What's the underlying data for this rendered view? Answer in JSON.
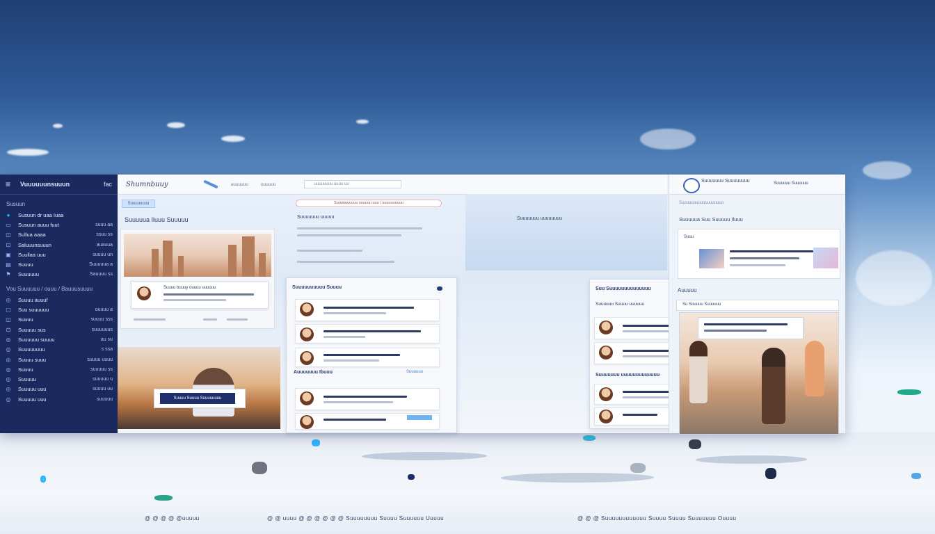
{
  "sidebar": {
    "title": "Vuuuuuunsuuun",
    "corner": "fac",
    "section1": "Susuun",
    "items_a": [
      {
        "icon": "dot-icon",
        "label": "Susuun dr uaa Iuaa",
        "value": ""
      },
      {
        "icon": "square-icon",
        "label": "Susuun auuu fuut",
        "value": "suuu aa"
      },
      {
        "icon": "chat-icon",
        "label": "Sullua aaaa",
        "value": "ssuu ss"
      },
      {
        "icon": "link-icon",
        "label": "Saluuunsuuun",
        "value": "auauua"
      },
      {
        "icon": "image-icon",
        "label": "Suullaa uuu",
        "value": "suuuu un"
      },
      {
        "icon": "doc-icon",
        "label": "Suuuu",
        "value": "Suuuuua a"
      },
      {
        "icon": "flag-icon",
        "label": "Suuuuuu",
        "value": "Sauuuu ss"
      }
    ],
    "section2": "Vou Suuuuuu / ouuu / Bauuusuuuu",
    "items_b": [
      {
        "icon": "circle-icon",
        "label": "Suuuu auuuf",
        "value": ""
      },
      {
        "icon": "box-icon",
        "label": "Suu suuuuuu",
        "value": "ouuuu a"
      },
      {
        "icon": "chat-icon",
        "label": "Suuuu",
        "value": "suuuu sss"
      },
      {
        "icon": "link-icon",
        "label": "Suuuuu sus",
        "value": "suuuuuus"
      },
      {
        "icon": "circle-icon",
        "label": "Suuuuuu suuuu",
        "value": "au su"
      },
      {
        "icon": "circle-icon",
        "label": "Suuuuuuuu",
        "value": "s ssa"
      },
      {
        "icon": "circle-icon",
        "label": "Suuuu suuu",
        "value": "suuuu uuuu"
      },
      {
        "icon": "circle-icon",
        "label": "Suuuu",
        "value": "suuuuu ss"
      },
      {
        "icon": "circle-icon",
        "label": "Suuuuu",
        "value": "suuuuu u"
      },
      {
        "icon": "circle-icon",
        "label": "Suuuuu uuu",
        "value": "suuuu uu"
      },
      {
        "icon": "circle-icon",
        "label": "Suuuuu uuu",
        "value": "suuuuu"
      }
    ]
  },
  "toolbar": {
    "brand": "Shumnbuuy",
    "tab1": "uuuuuuu",
    "tab2": "ouuuuu",
    "search": "uuuuuuuu uuuu uu"
  },
  "col1": {
    "tag": "Suuuuuuuu",
    "title": "Suuuuua Iluuu Suuuuu",
    "card_line": "Suuuu buuuy ouuuu uuuuuu",
    "plate": "Suuuu Suuuu Suuuuuuuu"
  },
  "col2": {
    "banner": "Suuuuuuuuuu suuuuu uuu / uuuuuuuuuu",
    "sub1": "Suuuuuuu uuuuu",
    "sub2": "Suuuuuuu uuuuuuuu",
    "panel1": {
      "header": "Suuuuuuuuuu Suuuu",
      "subhead": "Auuuuuuu Ibuuu",
      "tag": "Suuuuuu"
    },
    "panel2": {
      "header": "Suu Suuuuuuuuuuuuuu",
      "sub": "Suuuuuu Suuuu uuuuuu",
      "subhead": "Suuuuuuu uuuuuuuuuuuuu"
    }
  },
  "right": {
    "title": "Suuuuuuu Suuuuuuuu",
    "meta": "Suuuuuu Suuuuuu",
    "strip": "Suuuuuuuuuuuuuuuuuu",
    "title2": "Suuuuua Suu Suuuuu Iluuu",
    "card_tag": "Suuu",
    "section": "Auuuuu",
    "search": "Su Suuuuu Suuuuuu"
  },
  "footer": {
    "left": "@ @ @ @ @uuuuu",
    "middle": "@ @ uuuu @ @ @ @ @ @ Suuuuuuuu Suuuu Suuuuuu Uuuuu",
    "right": "@ @ @ Suuuuuuuuuuuu Suuuu Suuuu Suuuuuuu Ouuuu"
  }
}
